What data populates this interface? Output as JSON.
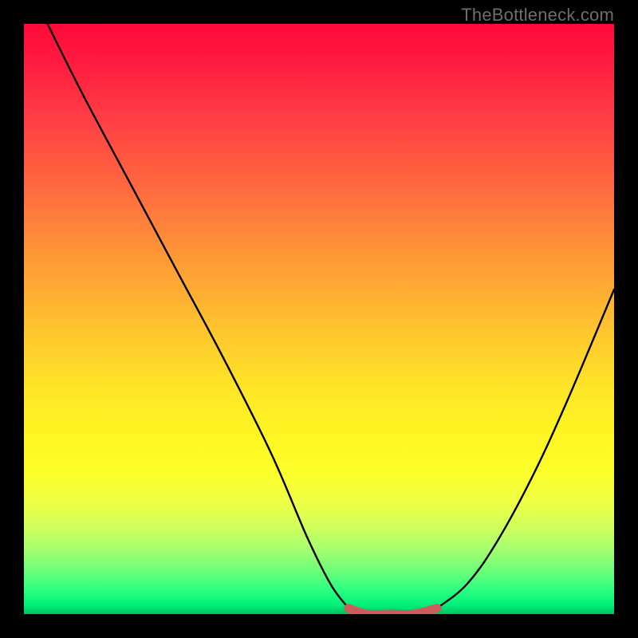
{
  "attribution": "TheBottleneck.com",
  "colors": {
    "frame": "#000000",
    "curve": "#000000",
    "recommended_segment": "#cd5c5c",
    "gradient_top": "#ff0a3a",
    "gradient_mid": "#ffe627",
    "gradient_bottom": "#00c060"
  },
  "chart_data": {
    "type": "line",
    "title": "",
    "xlabel": "",
    "ylabel": "",
    "xlim": [
      0,
      100
    ],
    "ylim": [
      0,
      100
    ],
    "grid": false,
    "legend": false,
    "annotations": [],
    "series": [
      {
        "name": "bottleneck-curve-left",
        "x": [
          4,
          10,
          18,
          26,
          34,
          42,
          48,
          52,
          55
        ],
        "y": [
          100,
          88,
          73,
          58,
          43,
          27,
          13,
          5,
          1
        ]
      },
      {
        "name": "recommended-zone",
        "x": [
          55,
          58,
          62,
          66,
          70
        ],
        "y": [
          1,
          0,
          0,
          0,
          1
        ]
      },
      {
        "name": "bottleneck-curve-right",
        "x": [
          70,
          75,
          80,
          86,
          92,
          100
        ],
        "y": [
          1,
          5,
          12,
          23,
          36,
          55
        ]
      }
    ]
  }
}
